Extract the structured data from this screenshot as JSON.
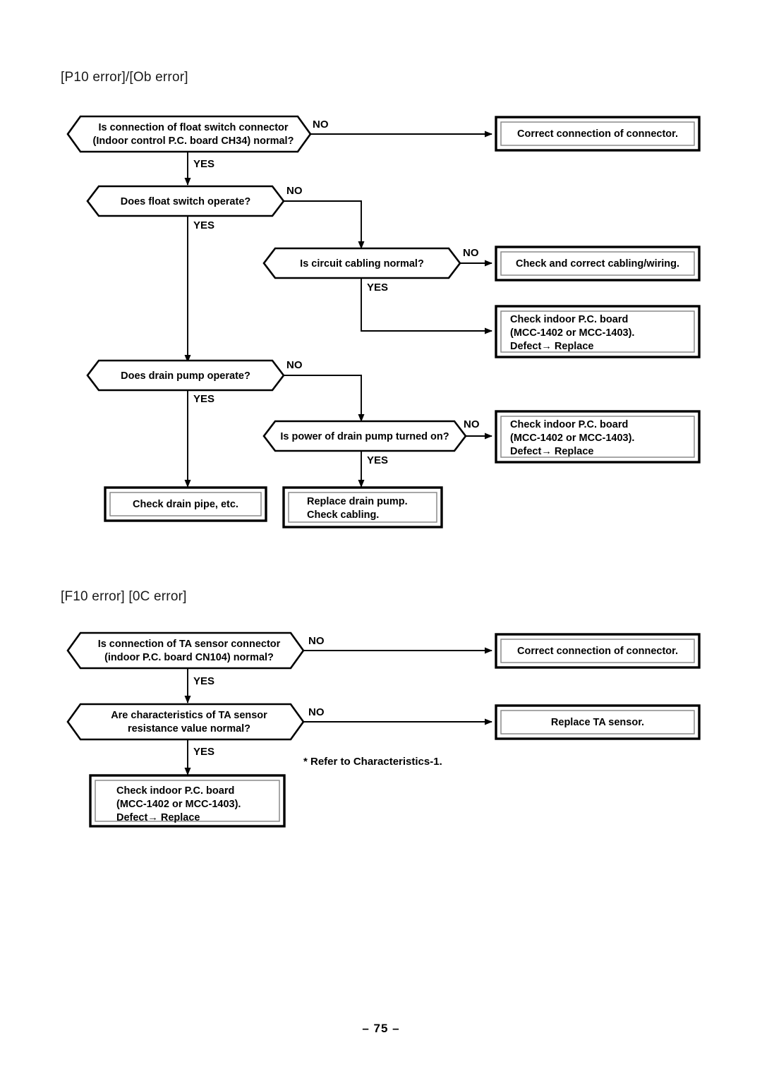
{
  "page": {
    "number_label": "– 75 –"
  },
  "sections": [
    {
      "id": "p10",
      "title": "[P10 error]/[Ob error]",
      "decisions": [
        {
          "id": "float-switch-connector",
          "lines": [
            "Is connection of float switch connector",
            "(Indoor control P.C. board CH34) normal?"
          ],
          "yes_label": "YES",
          "no_label": "NO"
        },
        {
          "id": "float-switch-operate",
          "lines": [
            "Does float switch operate?"
          ],
          "yes_label": "YES",
          "no_label": "NO"
        },
        {
          "id": "circuit-cabling",
          "lines": [
            "Is circuit cabling normal?"
          ],
          "yes_label": "YES",
          "no_label": "NO"
        },
        {
          "id": "drain-pump-operate",
          "lines": [
            "Does drain pump operate?"
          ],
          "yes_label": "YES",
          "no_label": "NO"
        },
        {
          "id": "drain-pump-power",
          "lines": [
            "Is power of drain pump turned on?"
          ],
          "yes_label": "YES",
          "no_label": "NO"
        }
      ],
      "actions": [
        {
          "id": "correct-connection",
          "lines": [
            "Correct connection of connector."
          ]
        },
        {
          "id": "check-correct-cabling",
          "lines": [
            "Check and correct cabling/wiring."
          ]
        },
        {
          "id": "check-board-cabling",
          "lines": [
            "Check indoor P.C. board",
            "(MCC-1402 or MCC-1403).",
            "Defect→ Replace"
          ]
        },
        {
          "id": "check-board-pump",
          "lines": [
            "Check indoor P.C. board",
            "(MCC-1402 or MCC-1403).",
            "Defect→ Replace"
          ]
        },
        {
          "id": "check-drain-pipe",
          "lines": [
            "Check drain pipe, etc."
          ]
        },
        {
          "id": "replace-drain-pump",
          "lines": [
            "Replace drain pump.",
            "Check cabling."
          ]
        }
      ]
    },
    {
      "id": "f10",
      "title": "[F10 error] [0C error]",
      "decisions": [
        {
          "id": "ta-sensor-connector",
          "lines": [
            "Is connection of TA sensor connector",
            "(indoor P.C. board CN104) normal?"
          ],
          "yes_label": "YES",
          "no_label": "NO"
        },
        {
          "id": "ta-sensor-resistance",
          "lines": [
            "Are characteristics of TA sensor",
            "resistance value normal?"
          ],
          "yes_label": "YES",
          "no_label": "NO"
        }
      ],
      "actions": [
        {
          "id": "correct-connection",
          "lines": [
            "Correct connection of connector."
          ]
        },
        {
          "id": "replace-ta-sensor",
          "lines": [
            "Replace TA sensor."
          ]
        },
        {
          "id": "check-board-ta",
          "lines": [
            "Check indoor P.C. board",
            "(MCC-1402 or MCC-1403).",
            "Defect→ Replace"
          ]
        }
      ],
      "note": "* Refer to Characteristics-1."
    }
  ]
}
